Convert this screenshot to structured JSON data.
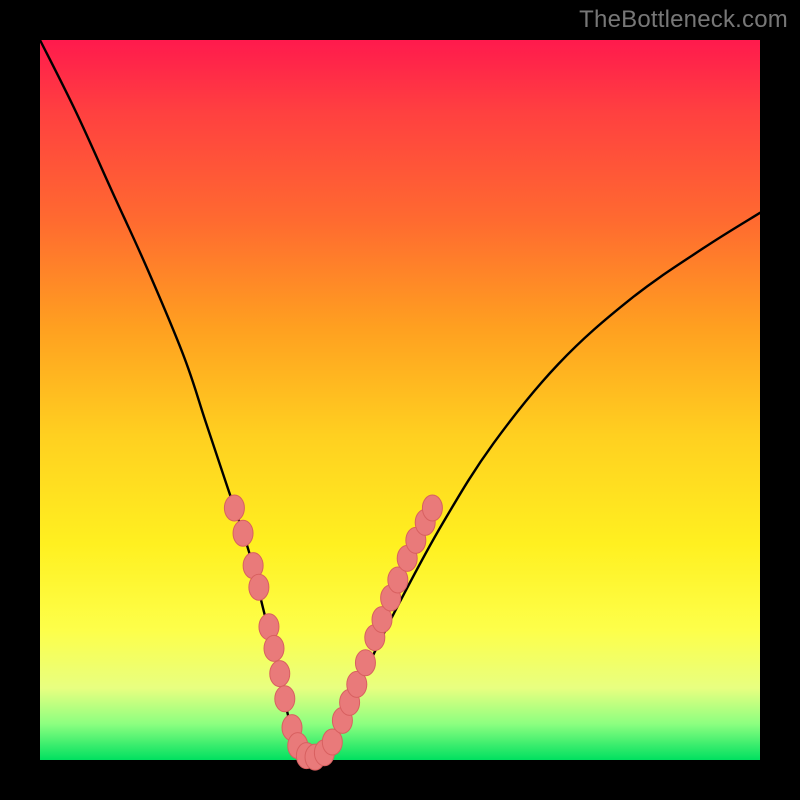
{
  "watermark": "TheBottleneck.com",
  "colors": {
    "frame_bg_top": "#ff1a4d",
    "frame_bg_bottom": "#00e060",
    "curve_stroke": "#000000",
    "bead_fill": "#e97a7a",
    "bead_stroke": "#d86060",
    "page_bg": "#000000"
  },
  "chart_data": {
    "type": "line",
    "title": "",
    "xlabel": "",
    "ylabel": "",
    "xlim": [
      0,
      100
    ],
    "ylim": [
      0,
      100
    ],
    "series": [
      {
        "name": "bottleneck-curve",
        "x": [
          0,
          5,
          10,
          15,
          20,
          23,
          26,
          29,
          31,
          33,
          34.5,
          36,
          38,
          41,
          45,
          50,
          56,
          63,
          72,
          82,
          92,
          100
        ],
        "y": [
          100,
          90,
          79,
          68,
          56,
          47,
          38,
          29,
          21,
          13,
          6,
          1,
          0,
          4,
          12,
          22,
          33,
          44,
          55,
          64,
          71,
          76
        ]
      }
    ],
    "beads": {
      "name": "highlighted-points",
      "points": [
        {
          "x": 27.0,
          "y": 35.0
        },
        {
          "x": 28.2,
          "y": 31.5
        },
        {
          "x": 29.6,
          "y": 27.0
        },
        {
          "x": 30.4,
          "y": 24.0
        },
        {
          "x": 31.8,
          "y": 18.5
        },
        {
          "x": 32.5,
          "y": 15.5
        },
        {
          "x": 33.3,
          "y": 12.0
        },
        {
          "x": 34.0,
          "y": 8.5
        },
        {
          "x": 35.0,
          "y": 4.5
        },
        {
          "x": 35.8,
          "y": 2.0
        },
        {
          "x": 37.0,
          "y": 0.6
        },
        {
          "x": 38.2,
          "y": 0.4
        },
        {
          "x": 39.5,
          "y": 1.0
        },
        {
          "x": 40.6,
          "y": 2.5
        },
        {
          "x": 42.0,
          "y": 5.5
        },
        {
          "x": 43.0,
          "y": 8.0
        },
        {
          "x": 44.0,
          "y": 10.5
        },
        {
          "x": 45.2,
          "y": 13.5
        },
        {
          "x": 46.5,
          "y": 17.0
        },
        {
          "x": 47.5,
          "y": 19.5
        },
        {
          "x": 48.7,
          "y": 22.5
        },
        {
          "x": 49.7,
          "y": 25.0
        },
        {
          "x": 51.0,
          "y": 28.0
        },
        {
          "x": 52.2,
          "y": 30.5
        },
        {
          "x": 53.5,
          "y": 33.0
        },
        {
          "x": 54.5,
          "y": 35.0
        }
      ]
    }
  }
}
